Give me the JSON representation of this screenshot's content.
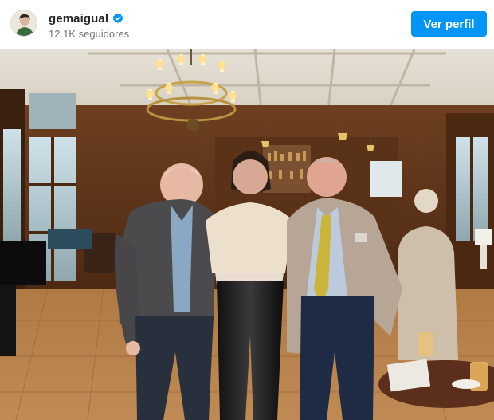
{
  "header": {
    "username": "gemaigual",
    "followers": "12.1K seguidores",
    "follow_label": "Ver perfil",
    "verified_icon": "verified-badge-icon",
    "colors": {
      "button": "#0095f6",
      "verified": "#0095f6"
    }
  },
  "photo": {
    "subject": "post-photo"
  }
}
